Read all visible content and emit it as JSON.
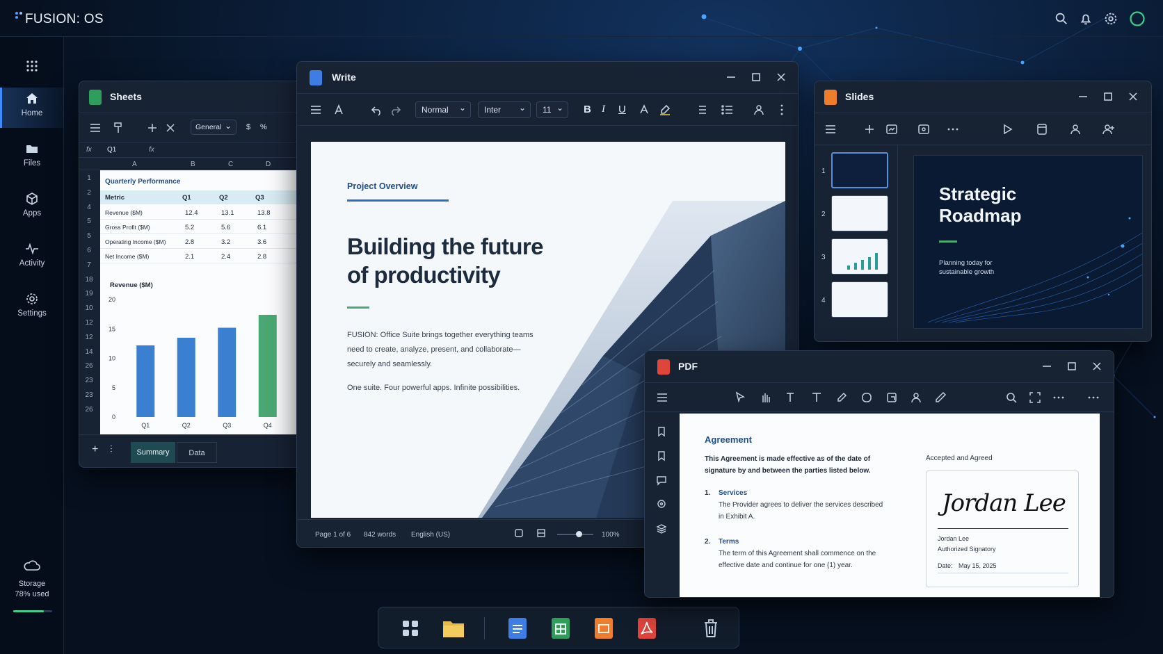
{
  "os": {
    "brand": "FUSION: OS",
    "storage_label": "Storage",
    "storage_used": "78% used",
    "storage_fraction": 0.78
  },
  "sidebar": {
    "items": [
      {
        "label": "Home",
        "icon": "home-icon"
      },
      {
        "label": "Files",
        "icon": "folder-icon"
      },
      {
        "label": "Apps",
        "icon": "cube-icon"
      },
      {
        "label": "Activity",
        "icon": "activity-icon"
      },
      {
        "label": "Settings",
        "icon": "gear-icon"
      }
    ]
  },
  "topbar": {
    "icons": [
      "search-icon",
      "bell-icon",
      "gear-icon",
      "status-ring-icon"
    ]
  },
  "sheets": {
    "title": "Sheets",
    "number_format": "General",
    "symbols": {
      "currency": "$",
      "percent": "%"
    },
    "fx": "fx",
    "name_box": "Q1",
    "columns": [
      "A",
      "B",
      "C",
      "D"
    ],
    "row_numbers": [
      "1",
      "2",
      "4",
      "5",
      "5",
      "6",
      "7",
      "18",
      "19",
      "10",
      "12",
      "12",
      "14",
      "26",
      "23",
      "23",
      "26"
    ],
    "table_title": "Quarterly Performance",
    "headers": [
      "Metric",
      "Q1",
      "Q2",
      "Q3"
    ],
    "rows": [
      [
        "Revenue ($M)",
        "12.4",
        "13.1",
        "13.8"
      ],
      [
        "Gross Profit ($M)",
        "5.2",
        "5.6",
        "6.1"
      ],
      [
        "Operating Income ($M)",
        "2.8",
        "3.2",
        "3.6"
      ],
      [
        "Net Income ($M)",
        "2.1",
        "2.4",
        "2.8"
      ]
    ],
    "tabs": [
      "Summary",
      "Data"
    ]
  },
  "chart_data": {
    "type": "bar",
    "title": "Revenue ($M)",
    "categories": [
      "Q1",
      "Q2",
      "Q3",
      "Q4"
    ],
    "values": [
      12.2,
      13.5,
      15.2,
      17.4
    ],
    "ylim": [
      0,
      20
    ],
    "yticks": [
      "20",
      "15",
      "10",
      "5",
      "0"
    ],
    "colors": [
      "#3b7fd0",
      "#3b7fd0",
      "#3b7fd0",
      "#4aa874"
    ],
    "grid": false
  },
  "write": {
    "title": "Write",
    "style": "Normal",
    "font": "Inter",
    "size": "11",
    "section": "Project Overview",
    "heading_line1": "Building the future",
    "heading_line2": "of productivity",
    "para1_line1": "FUSION: Office Suite brings together everything teams",
    "para1_line2": "need to create, analyze, present, and collaborate—",
    "para1_line3": "securely and seamlessly.",
    "para2": "One suite. Four powerful apps. Infinite possibilities.",
    "status_page": "Page 1 of 6",
    "status_words": "842 words",
    "status_lang": "English (US)",
    "zoom": "100%",
    "zoom_fraction": 0.6
  },
  "slides": {
    "title": "Slides",
    "thumbnails": [
      "1",
      "2",
      "3",
      "4"
    ],
    "slide_title_line1": "Strategic",
    "slide_title_line2": "Roadmap",
    "slide_sub_line1": "Planning today for",
    "slide_sub_line2": "sustainable growth"
  },
  "pdf": {
    "title": "PDF",
    "doc_title": "Agreement",
    "intro_line1": "This Agreement is made effective as of the date of",
    "intro_line2": "signature by and between the parties listed below.",
    "s1_num": "1.",
    "s1_title": "Services",
    "s1_line1": "The Provider agrees to deliver the services described",
    "s1_line2": "in Exhibit A.",
    "s2_num": "2.",
    "s2_title": "Terms",
    "s2_line1": "The term of this Agreement shall commence on the",
    "s2_line2": "effective date and continue for one (1) year.",
    "accepted": "Accepted and Agreed",
    "signature": "Jordan Lee",
    "signer_name": "Jordan Lee",
    "signer_role": "Authorized Signatory",
    "date_label": "Date:",
    "date_value": "May 15, 2025"
  },
  "dock": {
    "items": [
      "apps-grid-icon",
      "folder-icon",
      "write-app-icon",
      "sheets-app-icon",
      "slides-app-icon",
      "pdf-app-icon",
      "trash-icon"
    ]
  }
}
